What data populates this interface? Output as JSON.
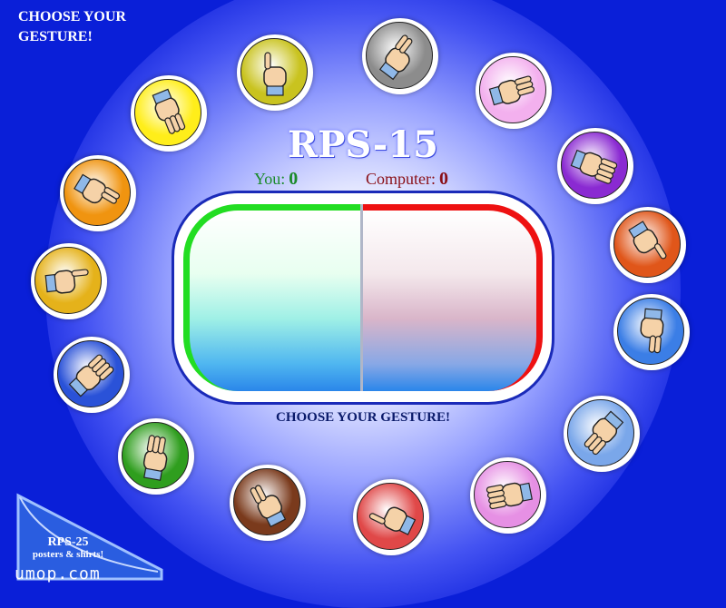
{
  "header": {
    "corner_title": "CHOOSE YOUR GESTURE!"
  },
  "game": {
    "title": "RPS-15",
    "score": {
      "you_label": "You:",
      "you_value": "0",
      "computer_label": "Computer:",
      "computer_value": "0"
    },
    "prompt": "CHOOSE YOUR GESTURE!"
  },
  "gestures": [
    {
      "name": "gesture-1",
      "color": "#c9c31f",
      "icon": "fist-icon"
    },
    {
      "name": "gesture-2",
      "color": "#8c8c8c",
      "icon": "pointing-finger-icon"
    },
    {
      "name": "gesture-3",
      "color": "#f3b0ee",
      "icon": "pinky-thumb-icon"
    },
    {
      "name": "gesture-4",
      "color": "#8a2ad2",
      "icon": "horns-icon"
    },
    {
      "name": "gesture-5",
      "color": "#e0561a",
      "icon": "flame-hand-icon"
    },
    {
      "name": "gesture-6",
      "color": "#3b7ee6",
      "icon": "open-hand-down-icon"
    },
    {
      "name": "gesture-7",
      "color": "#7aa7ea",
      "icon": "ok-hand-icon"
    },
    {
      "name": "gesture-8",
      "color": "#e690e4",
      "icon": "flat-hand-icon"
    },
    {
      "name": "gesture-9",
      "color": "#e04848",
      "icon": "rock-fist-icon"
    },
    {
      "name": "gesture-10",
      "color": "#7a3a1c",
      "icon": "l-shape-hand-icon"
    },
    {
      "name": "gesture-11",
      "color": "#2f9e1e",
      "icon": "thumbs-down-icon"
    },
    {
      "name": "gesture-12",
      "color": "#2a52d8",
      "icon": "walking-fingers-icon"
    },
    {
      "name": "gesture-13",
      "color": "#e5b21a",
      "icon": "pinch-hand-icon"
    },
    {
      "name": "gesture-14",
      "color": "#f09410",
      "icon": "peace-sign-icon"
    },
    {
      "name": "gesture-15",
      "color": "#ffee1a",
      "icon": "three-fingers-icon"
    }
  ],
  "promo": {
    "line1": "RPS-25",
    "line2": "posters & shirts!",
    "site": "umop.com"
  }
}
